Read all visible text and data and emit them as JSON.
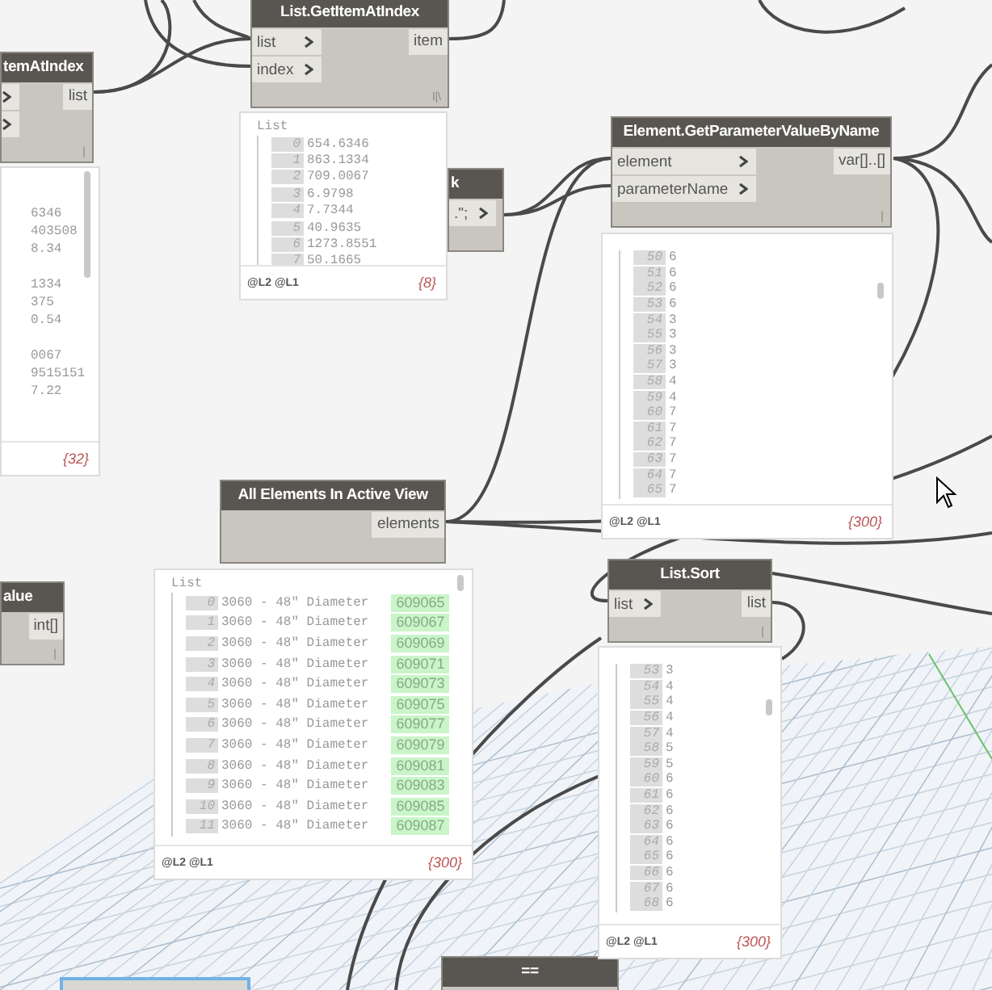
{
  "nodes": [
    {
      "title": "temAtIndex",
      "selected": false,
      "inputs": [
        {
          "kind": "unlabeled"
        },
        {
          "kind": "unlabeled"
        }
      ],
      "outputs": [
        {
          "label": "list"
        }
      ],
      "lacing": "|",
      "preview": {
        "groups": [
          [
            "6346",
            "403508",
            "8.34"
          ],
          [
            "1334",
            "375",
            "0.54"
          ],
          [
            "0067",
            "9515151",
            "7.22"
          ]
        ],
        "count": "{32}"
      }
    },
    {
      "title": "List.GetItemAtIndex",
      "selected": false,
      "inputs": [
        {
          "label": "list"
        },
        {
          "label": "index"
        }
      ],
      "outputs": [
        {
          "label": "item"
        }
      ],
      "lacing": "l|\\",
      "preview": {
        "header": "List",
        "rows": [
          {
            "index": "0",
            "value": "654.6346"
          },
          {
            "index": "1",
            "value": "863.1334"
          },
          {
            "index": "2",
            "value": "709.0067"
          },
          {
            "index": "3",
            "value": "6.9798"
          },
          {
            "index": "4",
            "value": "7.7344"
          },
          {
            "index": "5",
            "value": "40.9635"
          },
          {
            "index": "6",
            "value": "1273.8551"
          },
          {
            "index": "7",
            "value": "50.1665"
          }
        ],
        "footer": "@L2 @L1",
        "count": "{8}"
      }
    },
    {
      "title": "k",
      "selected": false,
      "inputs": [
        {
          "label": ".\";"
        }
      ]
    },
    {
      "title": "Element.GetParameterValueByName",
      "selected": false,
      "inputs": [
        {
          "label": "element"
        },
        {
          "label": "parameterName"
        }
      ],
      "outputs": [
        {
          "label": "var[]..[]"
        }
      ],
      "lacing": "|",
      "preview": {
        "rows": [
          {
            "index": "50",
            "value": "6"
          },
          {
            "index": "51",
            "value": "6"
          },
          {
            "index": "52",
            "value": "6"
          },
          {
            "index": "53",
            "value": "6"
          },
          {
            "index": "54",
            "value": "3"
          },
          {
            "index": "55",
            "value": "3"
          },
          {
            "index": "56",
            "value": "3"
          },
          {
            "index": "57",
            "value": "3"
          },
          {
            "index": "58",
            "value": "4"
          },
          {
            "index": "59",
            "value": "4"
          },
          {
            "index": "60",
            "value": "7"
          },
          {
            "index": "61",
            "value": "7"
          },
          {
            "index": "62",
            "value": "7"
          },
          {
            "index": "63",
            "value": "7"
          },
          {
            "index": "64",
            "value": "7"
          },
          {
            "index": "65",
            "value": "7"
          }
        ],
        "footer": "@L2 @L1",
        "count": "{300}"
      }
    },
    {
      "title": "All Elements In Active View",
      "selected": false,
      "outputs": [
        {
          "label": "elements"
        }
      ],
      "preview": {
        "header": "List",
        "rows": [
          {
            "index": "0",
            "value": "3060 - 48\" Diameter",
            "element_id": "609065"
          },
          {
            "index": "1",
            "value": "3060 - 48\" Diameter",
            "element_id": "609067"
          },
          {
            "index": "2",
            "value": "3060 - 48\" Diameter",
            "element_id": "609069"
          },
          {
            "index": "3",
            "value": "3060 - 48\" Diameter",
            "element_id": "609071"
          },
          {
            "index": "4",
            "value": "3060 - 48\" Diameter",
            "element_id": "609073"
          },
          {
            "index": "5",
            "value": "3060 - 48\" Diameter",
            "element_id": "609075"
          },
          {
            "index": "6",
            "value": "3060 - 48\" Diameter",
            "element_id": "609077"
          },
          {
            "index": "7",
            "value": "3060 - 48\" Diameter",
            "element_id": "609079"
          },
          {
            "index": "8",
            "value": "3060 - 48\" Diameter",
            "element_id": "609081"
          },
          {
            "index": "9",
            "value": "3060 - 48\" Diameter",
            "element_id": "609083"
          },
          {
            "index": "10",
            "value": "3060 - 48\" Diameter",
            "element_id": "609085"
          },
          {
            "index": "11",
            "value": "3060 - 48\" Diameter",
            "element_id": "609087"
          }
        ],
        "footer": "@L2 @L1",
        "count": "{300}"
      }
    },
    {
      "title": "alue",
      "selected": false,
      "outputs": [
        {
          "label": "int[]"
        }
      ],
      "lacing": "|"
    },
    {
      "title": "List.Sort",
      "selected": false,
      "inputs": [
        {
          "label": "list"
        }
      ],
      "outputs": [
        {
          "label": "list"
        }
      ],
      "lacing": "|",
      "preview": {
        "rows": [
          {
            "index": "53",
            "value": "3"
          },
          {
            "index": "54",
            "value": "4"
          },
          {
            "index": "55",
            "value": "4"
          },
          {
            "index": "56",
            "value": "4"
          },
          {
            "index": "57",
            "value": "4"
          },
          {
            "index": "58",
            "value": "5"
          },
          {
            "index": "59",
            "value": "5"
          },
          {
            "index": "60",
            "value": "6"
          },
          {
            "index": "61",
            "value": "6"
          },
          {
            "index": "62",
            "value": "6"
          },
          {
            "index": "63",
            "value": "6"
          },
          {
            "index": "64",
            "value": "6"
          },
          {
            "index": "65",
            "value": "6"
          },
          {
            "index": "66",
            "value": "6"
          },
          {
            "index": "67",
            "value": "6"
          },
          {
            "index": "68",
            "value": "6"
          }
        ],
        "footer": "@L2 @L1",
        "count": "{300}"
      }
    },
    {
      "title": "==",
      "selected": false
    },
    {
      "selected": true
    }
  ]
}
